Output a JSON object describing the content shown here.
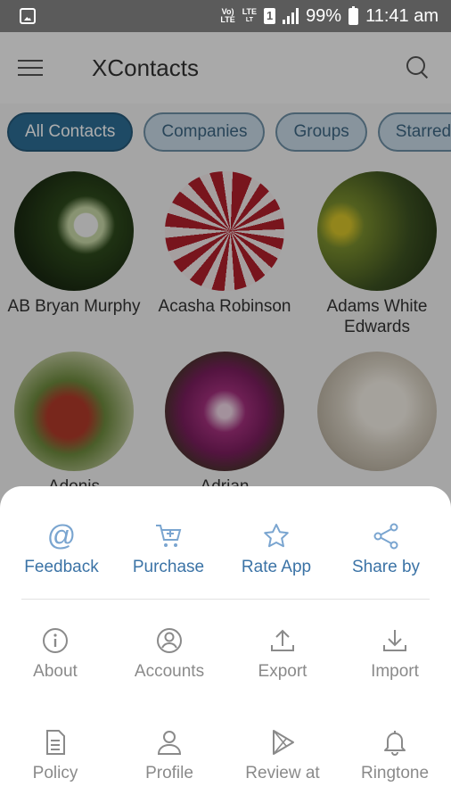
{
  "status_bar": {
    "net_top": "Vo)",
    "net_bottom": "LTE",
    "lte_top": "LTE",
    "lte_bottom": "LT",
    "sim": "1",
    "battery": "99%",
    "time": "11:41 am"
  },
  "header": {
    "title": "XContacts"
  },
  "tabs": [
    {
      "label": "All Contacts"
    },
    {
      "label": "Companies"
    },
    {
      "label": "Groups"
    },
    {
      "label": "Starred"
    }
  ],
  "contacts": [
    {
      "name": "AB Bryan Murphy"
    },
    {
      "name": "Acasha Robinson"
    },
    {
      "name": "Adams White Edwards"
    },
    {
      "name": "Adonis"
    },
    {
      "name": "Adrian"
    },
    {
      "name": ""
    }
  ],
  "sheet": {
    "row1": [
      {
        "label": "Feedback",
        "icon": "at-icon"
      },
      {
        "label": "Purchase",
        "icon": "cart-icon"
      },
      {
        "label": "Rate App",
        "icon": "star-icon"
      },
      {
        "label": "Share by",
        "icon": "share-icon"
      }
    ],
    "row2": [
      {
        "label": "About",
        "icon": "info-icon"
      },
      {
        "label": "Accounts",
        "icon": "account-circle-icon"
      },
      {
        "label": "Export",
        "icon": "upload-icon"
      },
      {
        "label": "Import",
        "icon": "download-icon"
      }
    ],
    "row3": [
      {
        "label": "Policy",
        "icon": "document-icon"
      },
      {
        "label": "Profile",
        "icon": "person-icon"
      },
      {
        "label": "Review at",
        "icon": "play-store-icon"
      },
      {
        "label": "Ringtone",
        "icon": "bell-icon"
      }
    ]
  },
  "colors": {
    "accent_blue": "#3b73a6",
    "active_tab": "#2d6e96",
    "status_bar": "#5b5b5b"
  }
}
